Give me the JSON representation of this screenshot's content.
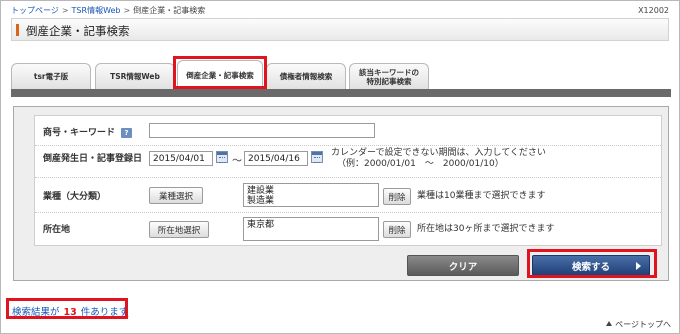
{
  "breadcrumb": {
    "items": [
      "トップページ",
      "TSR情報Web",
      "倒産企業・記事検索"
    ],
    "separator": ">"
  },
  "page_code": "X12002",
  "page_title": "倒産企業・記事検索",
  "tabs": [
    {
      "label": "tsr電子版"
    },
    {
      "label": "TSR情報Web"
    },
    {
      "label": "倒産企業・記事検索",
      "active": true
    },
    {
      "label": "債権者情報検索"
    },
    {
      "label_line1": "該当キーワードの",
      "label_line2": "特別記事検索"
    }
  ],
  "form": {
    "keyword": {
      "label": "商号・キーワード",
      "help": "?",
      "value": ""
    },
    "date": {
      "label": "倒産発生日・記事登録日",
      "from": "2015/04/01",
      "separator": "〜",
      "to": "2015/04/16",
      "note_line1": "カレンダーで設定できない期間は、入力してください",
      "note_line2": "（例：2000/01/01　～　2000/01/10）"
    },
    "industry": {
      "label": "業種（大分類）",
      "select_button": "業種選択",
      "value": "建設業\n製造業",
      "delete_button": "削除",
      "note": "業種は10業種まで選択できます"
    },
    "location": {
      "label": "所在地",
      "select_button": "所在地選択",
      "value": "東京都",
      "delete_button": "削除",
      "note": "所在地は30ヶ所まで選択できます"
    },
    "clear_button": "クリア",
    "search_button": "検索する"
  },
  "result": {
    "prefix": "検索結果が",
    "count": "13",
    "suffix": "件あります"
  },
  "page_top": "ページトップへ",
  "colors": {
    "highlight": "#e0141e",
    "link": "#1a56b8",
    "search_button": "#2a4c8a",
    "clear_button": "#6e6e6e",
    "title_accent": "#d9641a"
  }
}
